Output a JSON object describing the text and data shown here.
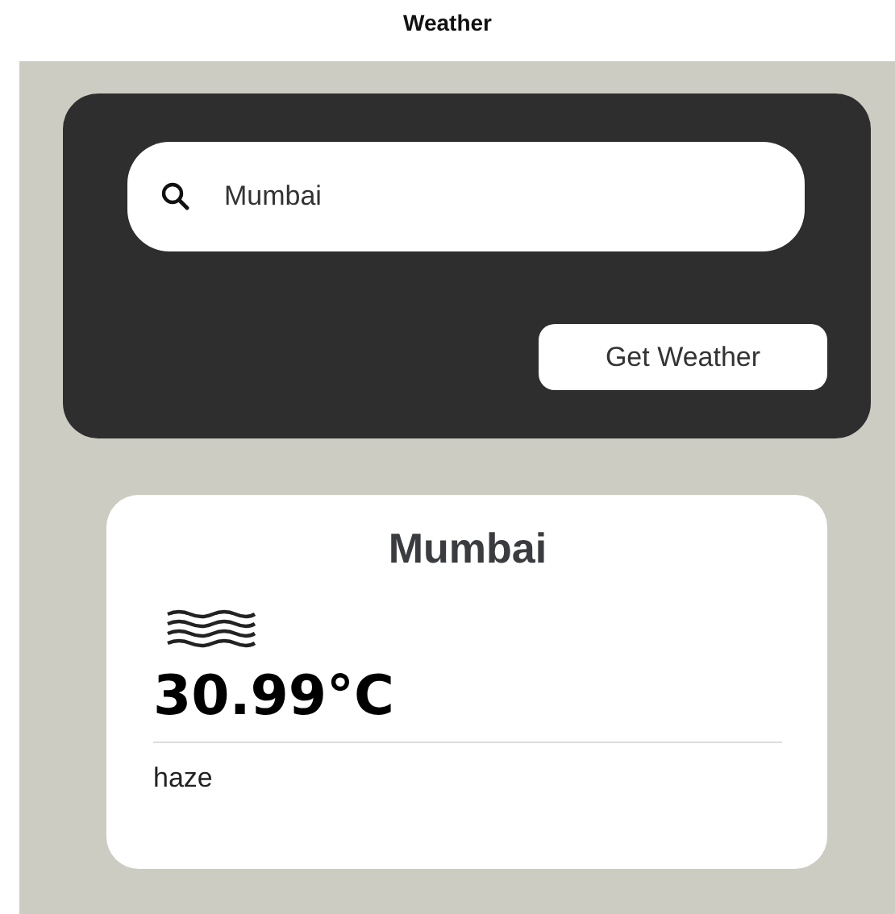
{
  "window": {
    "title": "Weather"
  },
  "search": {
    "value": "Mumbai"
  },
  "button": {
    "label": "Get Weather"
  },
  "result": {
    "city": "Mumbai",
    "temperature": "30.99°C",
    "description": "haze"
  }
}
